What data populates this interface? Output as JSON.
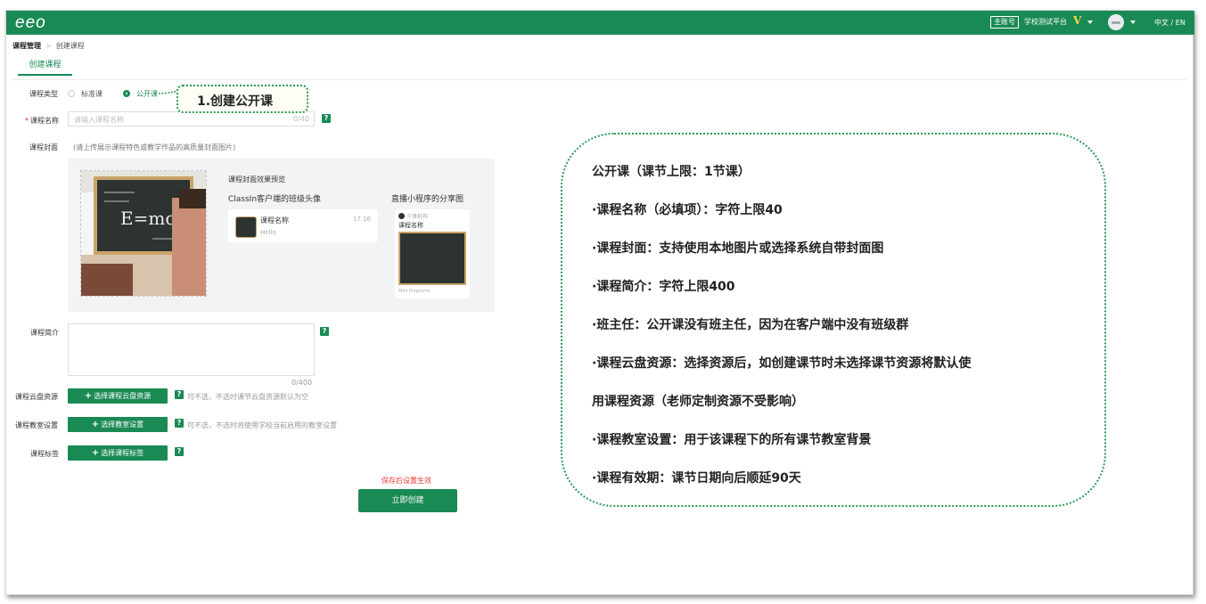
{
  "app": {
    "logo": "eeo",
    "account_tag": "主账号",
    "school_name": "学校测试平台",
    "vip_badge": "V",
    "language": "中文 / EN"
  },
  "breadcrumb": {
    "root": "课程管理",
    "separator": ">",
    "current": "创建课程"
  },
  "tab": {
    "label": "创建课程"
  },
  "form": {
    "course_type_label": "课程类型",
    "option_standard": "标准课",
    "option_public": "公开课",
    "selected": "公开课",
    "name_label": "课程名称",
    "name_placeholder": "请输入课程名称",
    "name_counter": "0/40",
    "cover_label": "课程封面",
    "cover_hint": "(请上传展示课程特色或教学作品的高质量封面图片)",
    "preview_title": "课程封面效果预览",
    "client_title": "ClassIn客户端的班级头像",
    "client_card_name": "课程名称",
    "client_card_time": "17:16",
    "client_card_msg": "Hello",
    "mini_title": "直播小程序的分享图",
    "mini_user": "千锋机构",
    "mini_course": "课程名称",
    "mini_footer": "Mini Programs",
    "intro_label": "课程简介",
    "intro_counter": "0/400",
    "cloud_label": "课程云盘资源",
    "cloud_button": "选择课程云盘资源",
    "cloud_hint": "可不选，不选时课节云盘资源默认为空",
    "room_label": "课程教室设置",
    "room_button": "选择教室设置",
    "room_hint": "可不选，不选时将使用学校当前启用的教室设置",
    "tag_label": "课程标签",
    "tag_button": "选择课程标签",
    "help_glyph": "?",
    "save_hint": "保存后设置生效",
    "create_button": "立即创建"
  },
  "annotation": {
    "callout": "1.创建公开课"
  },
  "info": {
    "lines": [
      "公开课（课节上限：1节课）",
      "·课程名称（必填项）：字符上限40",
      "·课程封面：支持使用本地图片或选择系统自带封面图",
      "·课程简介：字符上限400",
      "·班主任：公开课没有班主任，因为在客户端中没有班级群",
      "·课程云盘资源：选择资源后，如创建课节时未选择课节资源将默认使",
      "用课程资源（老师定制资源不受影响）",
      "·课程教室设置：用于该课程下的所有课节教室背景",
      "·课程有效期：课节日期向后顺延90天"
    ]
  },
  "colors": {
    "brand_green": "#1a8a55",
    "accent_red": "#e53935",
    "vip_gold": "#f3d54a"
  },
  "chalkboard_text": "E=mc²"
}
